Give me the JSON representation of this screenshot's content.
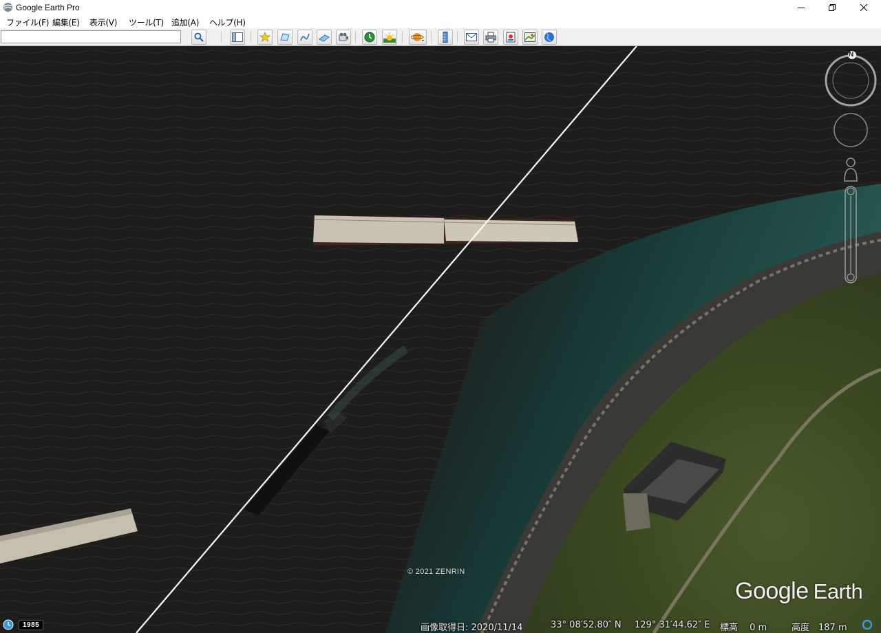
{
  "window": {
    "title": "Google Earth Pro",
    "controls": [
      "minimize-icon",
      "maximize-icon",
      "close-icon"
    ]
  },
  "menu": {
    "items": [
      {
        "label": "ファイル(F)"
      },
      {
        "label": "編集(E)"
      },
      {
        "label": "表示(V)"
      },
      {
        "label": "ツール(T)"
      },
      {
        "label": "追加(A)"
      },
      {
        "label": "ヘルプ(H)"
      }
    ]
  },
  "toolbar": {
    "search_value": "",
    "buttons": [
      "search-icon",
      "sidebar-toggle-icon",
      "add-placemark-icon",
      "add-polygon-icon",
      "add-path-icon",
      "add-image-overlay-icon",
      "record-tour-icon",
      "historical-imagery-icon",
      "sunlight-icon",
      "planets-icon",
      "ruler-icon",
      "email-icon",
      "print-icon",
      "save-image-icon",
      "view-in-google-maps-icon",
      "earth-icon"
    ]
  },
  "map": {
    "copyright": "© 2021 ZENRIN",
    "logo_main": "Google",
    "logo_sub": "Earth",
    "compass_label": "N"
  },
  "historical": {
    "year": "1985"
  },
  "status": {
    "imagery_date": "画像取得日: 2020/11/14",
    "latitude": "33° 08′52.80″ N",
    "longitude": "129° 31′44.62″ E",
    "elevation": "標高　 0 m",
    "eye_altitude": "高度　187 m"
  },
  "colors": {
    "sea": "#1f1d1c",
    "shallow_water": "#1f4a45",
    "coast_vegetation": "#3d4a23",
    "pier": "#c9c4b3",
    "path_line": "#ffffff"
  }
}
